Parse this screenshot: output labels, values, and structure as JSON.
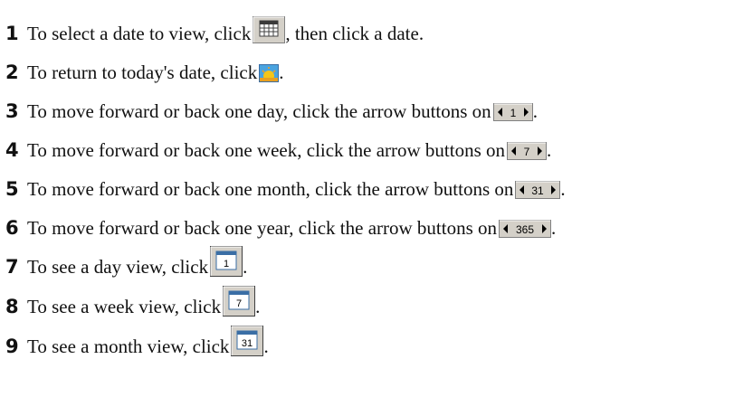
{
  "steps": [
    {
      "number": "1",
      "text": "To select a date to view, click ",
      "after": ", then click a date.",
      "button_icon": "calendar-grid-icon"
    },
    {
      "number": "2",
      "text": "To return to today's date, click ",
      "after": ".",
      "button_icon": "sunrise-today-icon"
    },
    {
      "number": "3",
      "text": "To move forward or back one day, click the arrow buttons on ",
      "after": ".",
      "button_label": "1",
      "button_icon": "day-arrow-buttons"
    },
    {
      "number": "4",
      "text": "To move forward or back one week, click the arrow buttons on ",
      "after": ".",
      "button_label": "7",
      "button_icon": "week-arrow-buttons"
    },
    {
      "number": "5",
      "text": "To move forward or back one month, click the arrow buttons on ",
      "after": ".",
      "button_label": "31",
      "button_icon": "month-arrow-buttons"
    },
    {
      "number": "6",
      "text": "To move forward or back one year, click the arrow buttons on ",
      "after": ".",
      "button_label": "365",
      "button_icon": "year-arrow-buttons"
    },
    {
      "number": "7",
      "text": "To see a day view, click ",
      "after": ".",
      "button_label": "1",
      "button_icon": "day-view-icon"
    },
    {
      "number": "8",
      "text": "To see a week view, click ",
      "after": ".",
      "button_label": "7",
      "button_icon": "week-view-icon"
    },
    {
      "number": "9",
      "text": "To see a month view, click ",
      "after": ".",
      "button_label": "31",
      "button_icon": "month-view-icon"
    }
  ],
  "colors": {
    "text": "#111111",
    "button_face": "#d4d0c8",
    "calendar_blue": "#3a6ea5",
    "sun": "#f5c518",
    "sky": "#4aa3df"
  }
}
